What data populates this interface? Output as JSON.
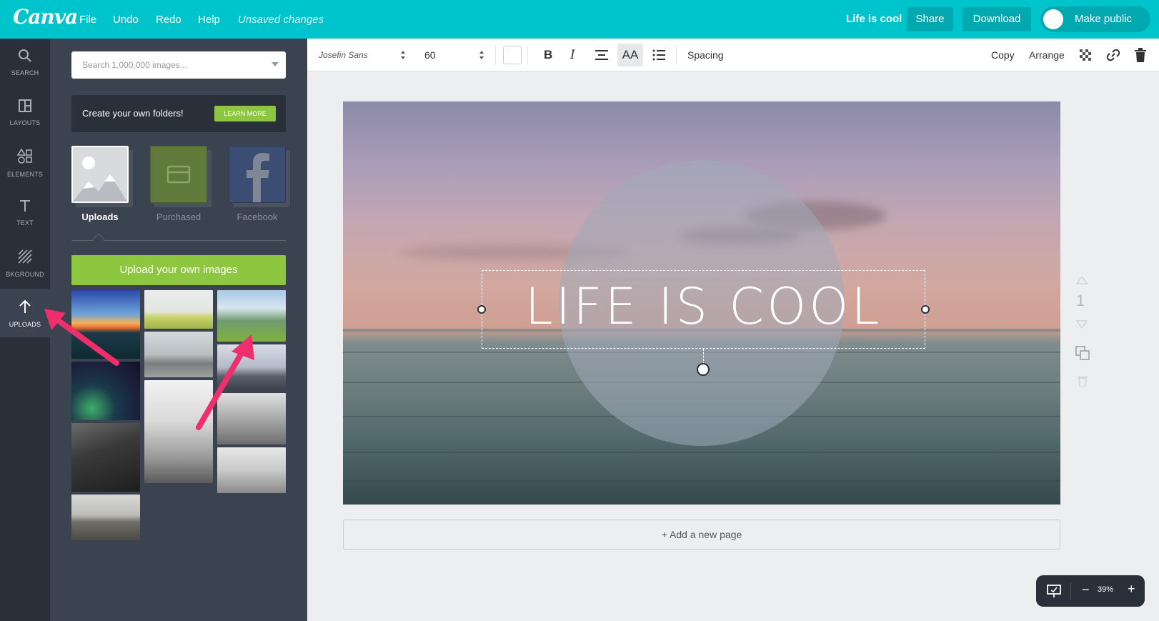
{
  "topbar": {
    "logo": "Canva",
    "menu": [
      "File",
      "Undo",
      "Redo",
      "Help"
    ],
    "status": "Unsaved changes",
    "doc_title": "Life is cool",
    "share": "Share",
    "download": "Download",
    "make_public": "Make public"
  },
  "rail": {
    "items": [
      "SEARCH",
      "LAYOUTS",
      "ELEMENTS",
      "TEXT",
      "BKGROUND",
      "UPLOADS"
    ],
    "active": "UPLOADS"
  },
  "panel": {
    "search_placeholder": "Search 1,000,000 images...",
    "folder_promo": "Create your own folders!",
    "learn_more": "LEARN MORE",
    "sources": [
      "Uploads",
      "Purchased",
      "Facebook"
    ],
    "upload_button": "Upload your own images"
  },
  "toolbar": {
    "font": "Josefin Sans",
    "size": "60",
    "bold": "B",
    "italic": "I",
    "case": "AA",
    "spacing": "Spacing",
    "copy": "Copy",
    "arrange": "Arrange"
  },
  "canvas": {
    "headline": "LIFE IS COOL",
    "add_page": "+ Add a new page",
    "page_number": "1",
    "zoom": "39%"
  },
  "colors": {
    "brand": "#00c4cc",
    "brand_dark": "#00a8b0",
    "rail_bg": "#293039",
    "panel_bg": "#3b4350",
    "green": "#8dc63f",
    "arrow": "#ee2f6b"
  }
}
